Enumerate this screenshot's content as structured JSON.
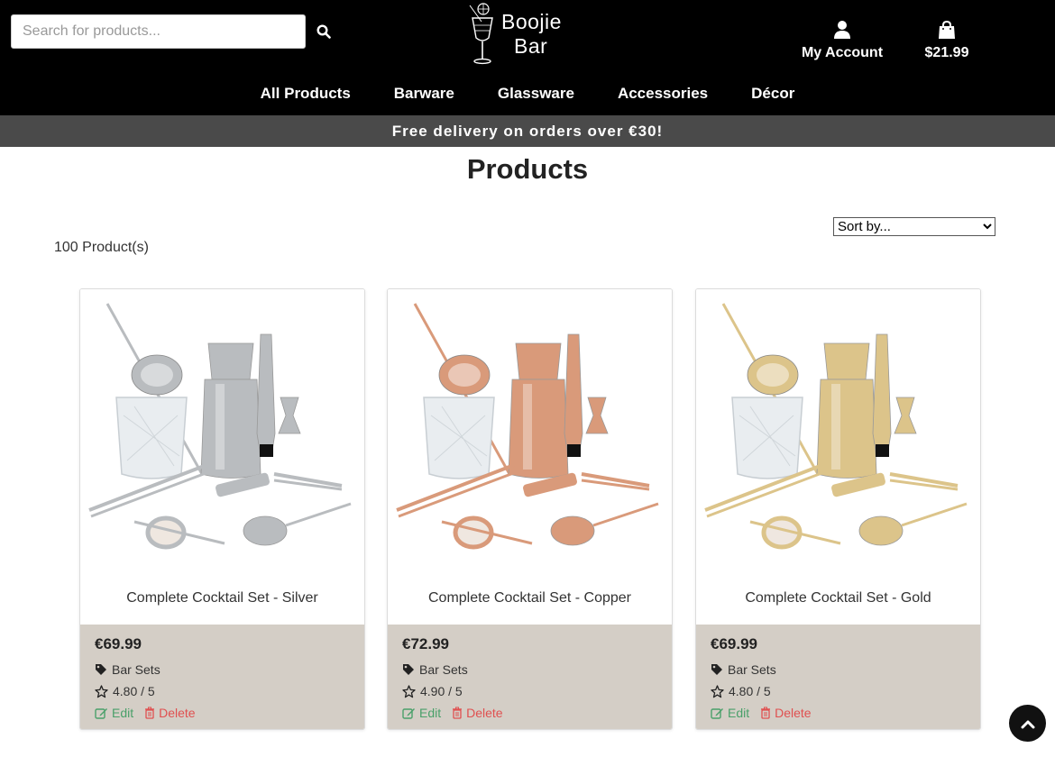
{
  "header": {
    "search": {
      "placeholder": "Search for products...",
      "value": ""
    },
    "logo": {
      "line1": "Boojie",
      "line2": "Bar"
    },
    "account_label": "My Account",
    "cart_total": "$21.99"
  },
  "nav": {
    "items": [
      {
        "label": "All Products"
      },
      {
        "label": "Barware"
      },
      {
        "label": "Glassware"
      },
      {
        "label": "Accessories"
      },
      {
        "label": "Décor"
      }
    ]
  },
  "promo_text": "Free delivery on orders over €30!",
  "main": {
    "title": "Products",
    "sort": {
      "selected": "Sort by..."
    },
    "count_text": "100 Product(s)",
    "products": [
      {
        "name": "Complete Cocktail Set - Silver",
        "price": "€69.99",
        "category": "Bar Sets",
        "rating": "4.80 / 5",
        "edit_label": "Edit",
        "delete_label": "Delete",
        "finish_color": "#b9bcbf"
      },
      {
        "name": "Complete Cocktail Set - Copper",
        "price": "€72.99",
        "category": "Bar Sets",
        "rating": "4.90 / 5",
        "edit_label": "Edit",
        "delete_label": "Delete",
        "finish_color": "#d99a7a"
      },
      {
        "name": "Complete Cocktail Set - Gold",
        "price": "€69.99",
        "category": "Bar Sets",
        "rating": "4.80 / 5",
        "edit_label": "Edit",
        "delete_label": "Delete",
        "finish_color": "#dcc48a"
      }
    ]
  },
  "colors": {
    "header_bg": "#000000",
    "promo_bg": "#4a4a4a",
    "card_footer_bg": "#d4cec6",
    "edit": "#4aa06a",
    "delete": "#e05050"
  }
}
